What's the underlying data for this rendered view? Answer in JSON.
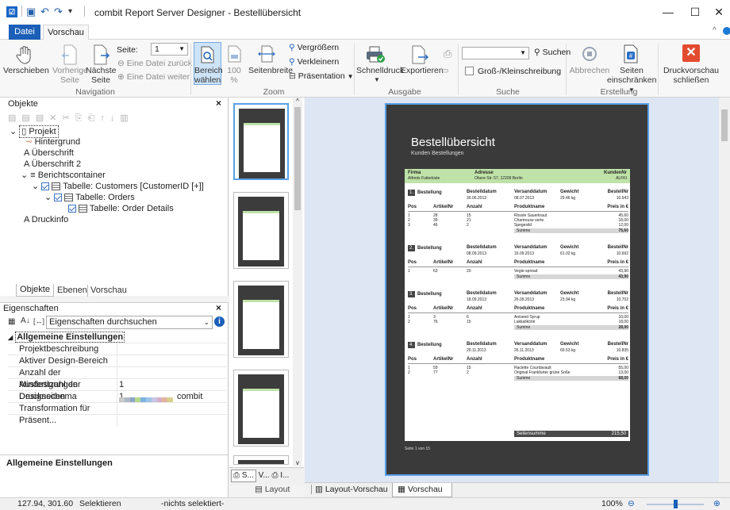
{
  "window": {
    "title": "combit Report Server Designer - Bestellübersicht",
    "app_icon": "combit-icon",
    "minimize": "—",
    "maximize": "☐",
    "close": "✕"
  },
  "tabs": [
    {
      "label": "Datei",
      "active": false
    },
    {
      "label": "Vorschau",
      "active": true
    }
  ],
  "ribbon": {
    "navigation": {
      "group_label": "Navigation",
      "pan": "Verschieben",
      "prev_page": [
        "Vorherige",
        "Seite"
      ],
      "next_page": [
        "Nächste",
        "Seite"
      ],
      "page_label": "Seite:",
      "page_value": "1",
      "prev_file": "Eine Datei zurück",
      "next_file": "Eine Datei weiter"
    },
    "zoom": {
      "group_label": "Zoom",
      "select_area": [
        "Bereich",
        "wählen"
      ],
      "hundred": [
        "100",
        "%"
      ],
      "page_width": "Seitenbreite",
      "zoom_in": "Vergrößern",
      "zoom_out": "Verkleinern",
      "presentation": "Präsentation"
    },
    "output": {
      "group_label": "Ausgabe",
      "quick_print": "Schnelldruck",
      "export": "Exportieren"
    },
    "search": {
      "group_label": "Suche",
      "search_value": "",
      "search_button": "Suchen",
      "match_case": "Groß-/Kleinschreibung",
      "match_case_checked": false
    },
    "creation": {
      "group_label": "Erstellung",
      "cancel": "Abbrechen",
      "restrict_pages": [
        "Seiten",
        "einschränken"
      ]
    },
    "close": {
      "close_preview": [
        "Druckvorschau",
        "schließen"
      ]
    }
  },
  "objects_panel": {
    "title": "Objekte",
    "tree": [
      {
        "label": "Projekt",
        "level": 0,
        "kind": "page"
      },
      {
        "label": "Hintergrund",
        "level": 1,
        "kind": "shape"
      },
      {
        "label": "Überschrift",
        "level": 1,
        "kind": "text"
      },
      {
        "label": "Überschrift 2",
        "level": 1,
        "kind": "text"
      },
      {
        "label": "Berichtscontainer",
        "level": 1,
        "kind": "container"
      },
      {
        "label": "Tabelle: Customers [CustomerID [+]]",
        "level": 2,
        "kind": "table"
      },
      {
        "label": "Tabelle: Orders",
        "level": 3,
        "kind": "table"
      },
      {
        "label": "Tabelle: Order Details",
        "level": 4,
        "kind": "table"
      },
      {
        "label": "Druckinfo",
        "level": 1,
        "kind": "text"
      }
    ],
    "bottom_tabs": [
      "Objekte",
      "Ebenen",
      "Vorschau"
    ]
  },
  "properties_panel": {
    "title": "Eigenschaften",
    "search_placeholder": "Eigenschaften durchsuchen",
    "category": "Allgemeine Einstellungen",
    "rows": [
      {
        "name": "Projektbeschreibung",
        "value": ""
      },
      {
        "name": "Aktiver Design-Bereich",
        "value": ""
      },
      {
        "name": "Anzahl der Ausfertigungen",
        "value": "1"
      },
      {
        "name": "Mindestzahl der Druckseiten",
        "value": "1"
      },
      {
        "name": "Designschema",
        "value": "combit"
      },
      {
        "name": "Transformation für Präsent...",
        "value": ""
      }
    ],
    "description_title": "Allgemeine Einstellungen",
    "design_scheme_colors": [
      "#c8c8c8",
      "#aeb8c8",
      "#8fa6c6",
      "#b6d88f",
      "#7eb3e0",
      "#9dc6e8",
      "#c6c6e2",
      "#d6b0c8",
      "#e2b59b",
      "#d8d08e"
    ]
  },
  "thumb_tabs": [
    "S...",
    "V...",
    "I..."
  ],
  "report": {
    "title": "Bestellübersicht",
    "subtitle": "Kunden Bestellungen",
    "header": {
      "firma_label": "Firma",
      "firma_value": "Alfreds Futterkiste",
      "adresse_label": "Adresse",
      "adresse_value": "Obere Str. 57, 12209 Berlin",
      "kunde_label": "KundenNr",
      "kunde_value": "ALFKI"
    },
    "col_labels": {
      "bestellung": "Bestellung",
      "bestelldatum": "Bestelldatum",
      "versanddatum": "Versanddatum",
      "gewicht": "Gewicht",
      "bestellnr": "BestellNr",
      "pos": "Pos",
      "artikelnr": "ArtikelNr",
      "anzahl": "Anzahl",
      "produktname": "Produktname",
      "preis": "Preis in €",
      "summe": "Summe"
    },
    "orders": [
      {
        "num": "1.",
        "bestelldatum": "30.06.2013",
        "versanddatum": "08.07.2013",
        "gewicht": "29.46 kg",
        "bestellnr": "10.643",
        "items": [
          {
            "pos": "1",
            "art": "28",
            "anz": "15",
            "name": "Rössle Sauerkraut",
            "preis": "45,60"
          },
          {
            "pos": "2",
            "art": "39",
            "anz": "21",
            "name": "Chartreuse verte",
            "preis": "18,00"
          },
          {
            "pos": "3",
            "art": "46",
            "anz": "2",
            "name": "Spegesild",
            "preis": "12,00"
          }
        ],
        "summe": "75,60"
      },
      {
        "num": "2.",
        "bestelldatum": "08.09.2013",
        "versanddatum": "16.09.2013",
        "gewicht": "61.02 kg",
        "bestellnr": "10.692",
        "items": [
          {
            "pos": "1",
            "art": "63",
            "anz": "20",
            "name": "Vegie-spread",
            "preis": "43,90"
          }
        ],
        "summe": "43,90"
      },
      {
        "num": "3.",
        "bestelldatum": "18.09.2013",
        "versanddatum": "26.09.2013",
        "gewicht": "23.94 kg",
        "bestellnr": "10.702",
        "items": [
          {
            "pos": "1",
            "art": "3",
            "anz": "6",
            "name": "Aniseed Syrup",
            "preis": "10,00"
          },
          {
            "pos": "2",
            "art": "76",
            "anz": "15",
            "name": "Lakkalikööri",
            "preis": "18,00"
          }
        ],
        "summe": "28,00"
      },
      {
        "num": "4.",
        "bestelldatum": "20.11.2013",
        "versanddatum": "26.11.2013",
        "gewicht": "69.53 kg",
        "bestellnr": "10.835",
        "items": [
          {
            "pos": "1",
            "art": "59",
            "anz": "15",
            "name": "Raclette Courdavault",
            "preis": "55,00"
          },
          {
            "pos": "2",
            "art": "77",
            "anz": "2",
            "name": "Original Frankfurter grüne Soße",
            "preis": "13,00"
          }
        ],
        "summe": "68,00"
      }
    ],
    "total_label": "Seitensumme",
    "total_value": "215,50",
    "page_info": "Seite 1 von 15"
  },
  "bottom_tabs": [
    {
      "label": "Layout",
      "active": false
    },
    {
      "label": "Layout-Vorschau",
      "active": false
    },
    {
      "label": "Vorschau",
      "active": true
    }
  ],
  "status": {
    "coords": "127.94, 301.60",
    "mode": "Selektieren",
    "selection": "-nichts selektiert-",
    "zoom": "100%"
  },
  "colors": {
    "accent": "#1b5fb8",
    "report_green": "#bfe2a8",
    "close_red": "#e34b2f"
  }
}
